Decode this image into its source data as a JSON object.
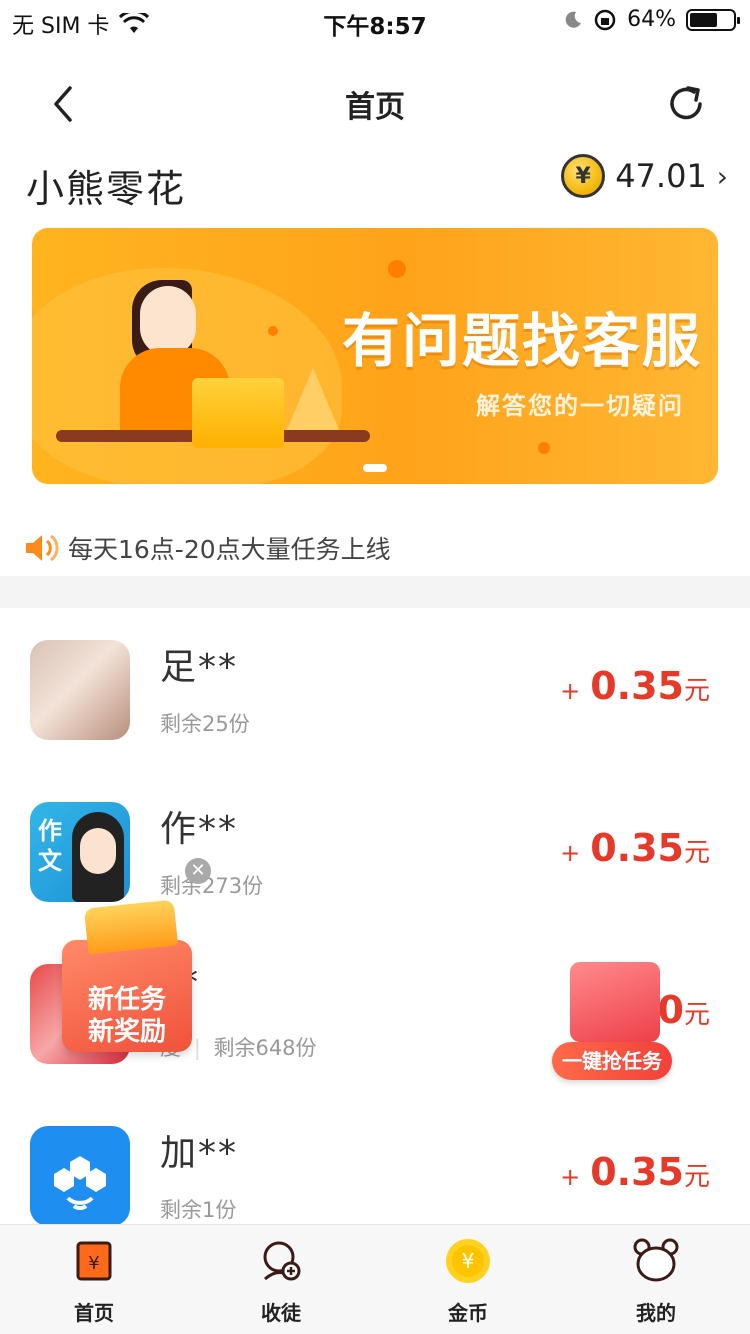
{
  "status_bar": {
    "carrier": "无 SIM 卡",
    "time": "下午8:57",
    "battery": "64%",
    "battery_level": 0.64
  },
  "nav": {
    "title": "首页"
  },
  "app": {
    "name": "小熊零花",
    "balance": "47.01"
  },
  "banner": {
    "headline": "有问题找客服",
    "subline": "解答您的一切疑问"
  },
  "notice": {
    "text": "每天16点-20点大量任务上线"
  },
  "tasks": [
    {
      "name": "足**",
      "remaining": "剩余25份",
      "plus": "+",
      "amount": "0.35",
      "unit": "元"
    },
    {
      "name": "作**",
      "remaining": "剩余273份",
      "plus": "+",
      "amount": "0.35",
      "unit": "元"
    },
    {
      "name": "**",
      "tag": "度",
      "remaining": "剩余648份",
      "amount": "0",
      "unit": "元"
    },
    {
      "name": "加**",
      "remaining": "剩余1份",
      "plus": "+",
      "amount": "0.35",
      "unit": "元"
    }
  ],
  "floats": {
    "new_task_line1": "新任务",
    "new_task_line2": "新奖励",
    "grab_label": "一键抢任务"
  },
  "tabbar": [
    {
      "label": "首页",
      "icon": "wallet-icon"
    },
    {
      "label": "收徒",
      "icon": "add-user-icon"
    },
    {
      "label": "金币",
      "icon": "coin-icon"
    },
    {
      "label": "我的",
      "icon": "bear-icon"
    }
  ],
  "colors": {
    "accent": "#ffa31a",
    "price": "#e53a2a"
  }
}
